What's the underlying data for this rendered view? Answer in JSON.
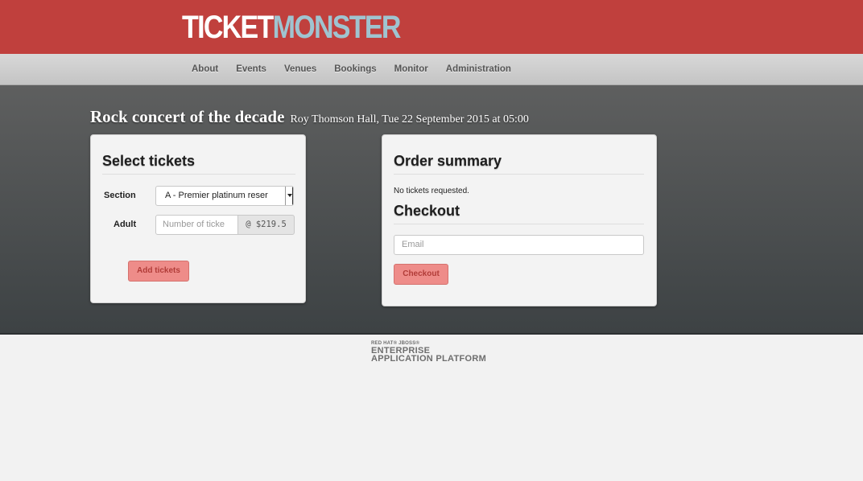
{
  "header": {
    "logo_part1": "TICKET",
    "logo_part2": "MONSTER"
  },
  "nav": {
    "items": [
      {
        "label": "About"
      },
      {
        "label": "Events"
      },
      {
        "label": "Venues"
      },
      {
        "label": "Bookings"
      },
      {
        "label": "Monitor"
      },
      {
        "label": "Administration"
      }
    ]
  },
  "event": {
    "name": "Rock concert of the decade",
    "details": "Roy Thomson Hall, Tue 22 September 2015 at 05:00"
  },
  "select_tickets": {
    "title": "Select tickets",
    "section_label": "Section",
    "section_value": "A - Premier platinum reser",
    "adult_label": "Adult",
    "quantity_placeholder": "Number of ticke",
    "price": "@ $219.5",
    "add_button": "Add tickets"
  },
  "order_summary": {
    "title": "Order summary",
    "empty_message": "No tickets requested.",
    "checkout_title": "Checkout",
    "email_placeholder": "Email",
    "checkout_button": "Checkout"
  },
  "footer": {
    "line1": "RED HAT® JBOSS®",
    "line2": "ENTERPRISE",
    "line3": "APPLICATION PLATFORM"
  },
  "colors": {
    "header_red": "#c0403d",
    "logo_blue": "#9fc4d0",
    "button_red": "#ee8c89"
  }
}
